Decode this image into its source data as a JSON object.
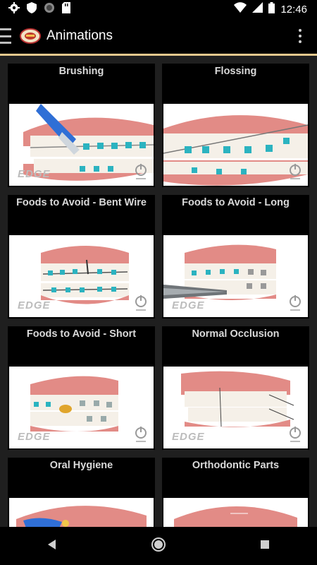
{
  "status": {
    "time": "12:46",
    "icons": [
      "gear-icon",
      "shield-icon",
      "circle-icon",
      "sdcard-icon",
      "wifi-icon",
      "signal-icon",
      "battery-icon"
    ]
  },
  "appbar": {
    "title": "Animations",
    "icons": [
      "menu-icon",
      "logo",
      "overflow-menu-icon"
    ]
  },
  "animations": [
    {
      "title": "Brushing",
      "brand": "EDGE"
    },
    {
      "title": "Flossing",
      "brand": ""
    },
    {
      "title": "Foods to Avoid - Bent Wire",
      "brand": "EDGE"
    },
    {
      "title": "Foods to Avoid - Long",
      "brand": "EDGE"
    },
    {
      "title": "Foods to Avoid - Short",
      "brand": "EDGE"
    },
    {
      "title": "Normal Occlusion",
      "brand": "EDGE"
    },
    {
      "title": "Oral Hygiene",
      "brand": ""
    },
    {
      "title": "Orthodontic Parts",
      "brand": ""
    }
  ],
  "navbar": {
    "icons": [
      "back-icon",
      "home-icon",
      "recents-icon"
    ]
  },
  "colors": {
    "accent_line": "#e5c88d",
    "gum": "#e28b86",
    "bracket": "#2bb3c0"
  }
}
